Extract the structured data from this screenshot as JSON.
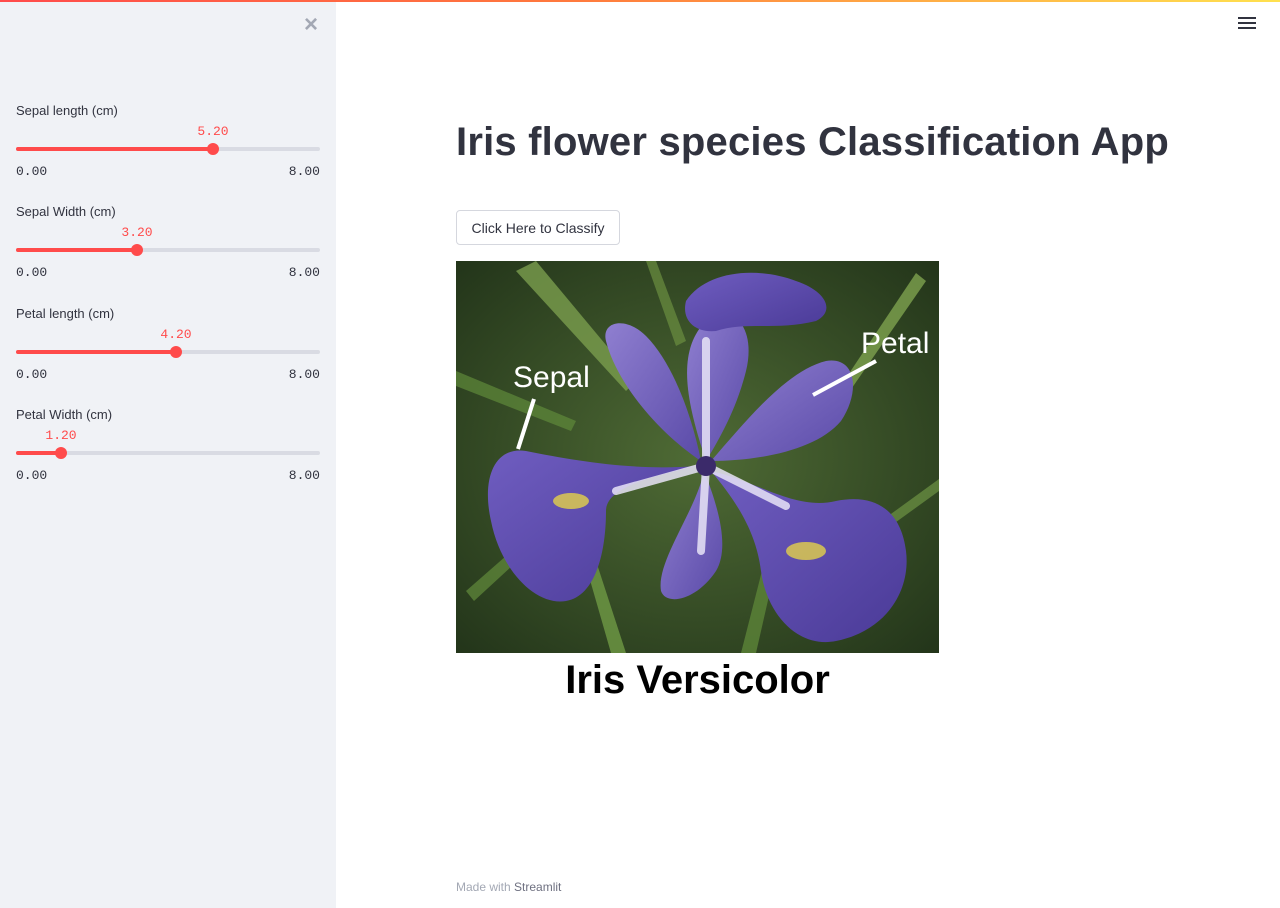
{
  "sidebar": {
    "close_icon": "close-icon",
    "sliders": [
      {
        "label": "Sepal length (cm)",
        "value": "5.20",
        "min": "0.00",
        "max": "8.00",
        "fraction": 0.65
      },
      {
        "label": "Sepal Width (cm)",
        "value": "3.20",
        "min": "0.00",
        "max": "8.00",
        "fraction": 0.4
      },
      {
        "label": "Petal length (cm)",
        "value": "4.20",
        "min": "0.00",
        "max": "8.00",
        "fraction": 0.525
      },
      {
        "label": "Petal Width (cm)",
        "value": "1.20",
        "min": "0.00",
        "max": "8.00",
        "fraction": 0.15
      }
    ]
  },
  "header": {
    "menu_icon": "hamburger-menu-icon"
  },
  "main": {
    "title": "Iris flower species Classification App",
    "classify_button": "Click Here to Classify",
    "image": {
      "label_sepal": "Sepal",
      "label_petal": "Petal"
    },
    "result": "Iris Versicolor"
  },
  "footer": {
    "prefix": "Made with",
    "brand": "Streamlit"
  },
  "colors": {
    "accent": "#ff4b4b",
    "sidebar_bg": "#f0f2f6",
    "text": "#31333f"
  }
}
